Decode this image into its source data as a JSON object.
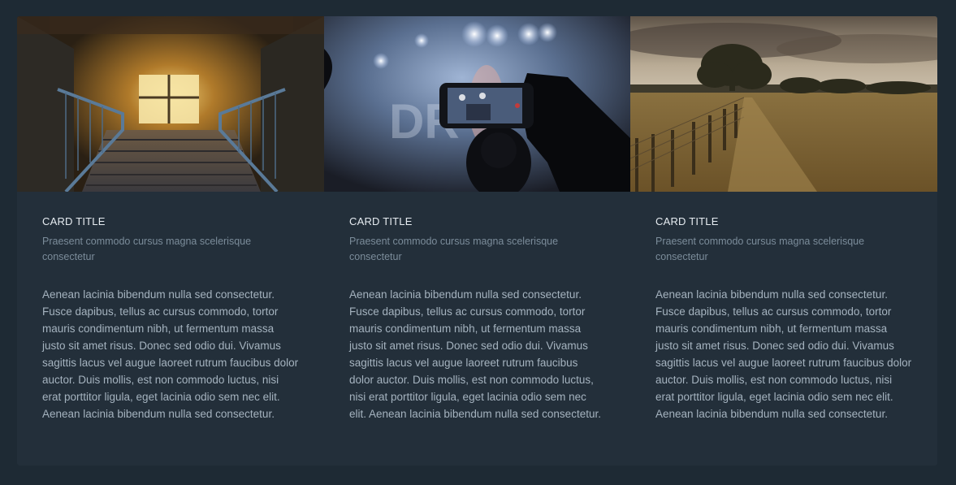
{
  "cards": [
    {
      "image": "abandoned-staircase-photo",
      "title": "CARD TITLE",
      "subtitle": "Praesent commodo cursus magna scelerisque consectetur",
      "text": "Aenean lacinia bibendum nulla sed consectetur. Fusce dapibus, tellus ac cursus commodo, tortor mauris condimentum nibh, ut fermentum massa justo sit amet risus. Donec sed odio dui. Vivamus sagittis lacus vel augue laoreet rutrum faucibus dolor auctor. Duis mollis, est non commodo luctus, nisi erat porttitor ligula, eget lacinia odio sem nec elit. Aenean lacinia bibendum nulla sed consectetur."
    },
    {
      "image": "concert-phone-photo",
      "title": "CARD TITLE",
      "subtitle": "Praesent commodo cursus magna scelerisque consectetur",
      "text": "Aenean lacinia bibendum nulla sed consectetur. Fusce dapibus, tellus ac cursus commodo, tortor mauris condimentum nibh, ut fermentum massa justo sit amet risus. Donec sed odio dui. Vivamus sagittis lacus vel augue laoreet rutrum faucibus dolor auctor. Duis mollis, est non commodo luctus, nisi erat porttitor ligula, eget lacinia odio sem nec elit. Aenean lacinia bibendum nulla sed consectetur."
    },
    {
      "image": "field-tree-fence-photo",
      "title": "CARD TITLE",
      "subtitle": "Praesent commodo cursus magna scelerisque consectetur",
      "text": "Aenean lacinia bibendum nulla sed consectetur. Fusce dapibus, tellus ac cursus commodo, tortor mauris condimentum nibh, ut fermentum massa justo sit amet risus. Donec sed odio dui. Vivamus sagittis lacus vel augue laoreet rutrum faucibus dolor auctor. Duis mollis, est non commodo luctus, nisi erat porttitor ligula, eget lacinia odio sem nec elit. Aenean lacinia bibendum nulla sed consectetur."
    }
  ],
  "colors": {
    "page_bg": "#1e2a34",
    "card_bg": "#232f3a",
    "title": "#e6ecf1",
    "subtitle": "#7b8c9a",
    "text": "#a5b3bf"
  }
}
